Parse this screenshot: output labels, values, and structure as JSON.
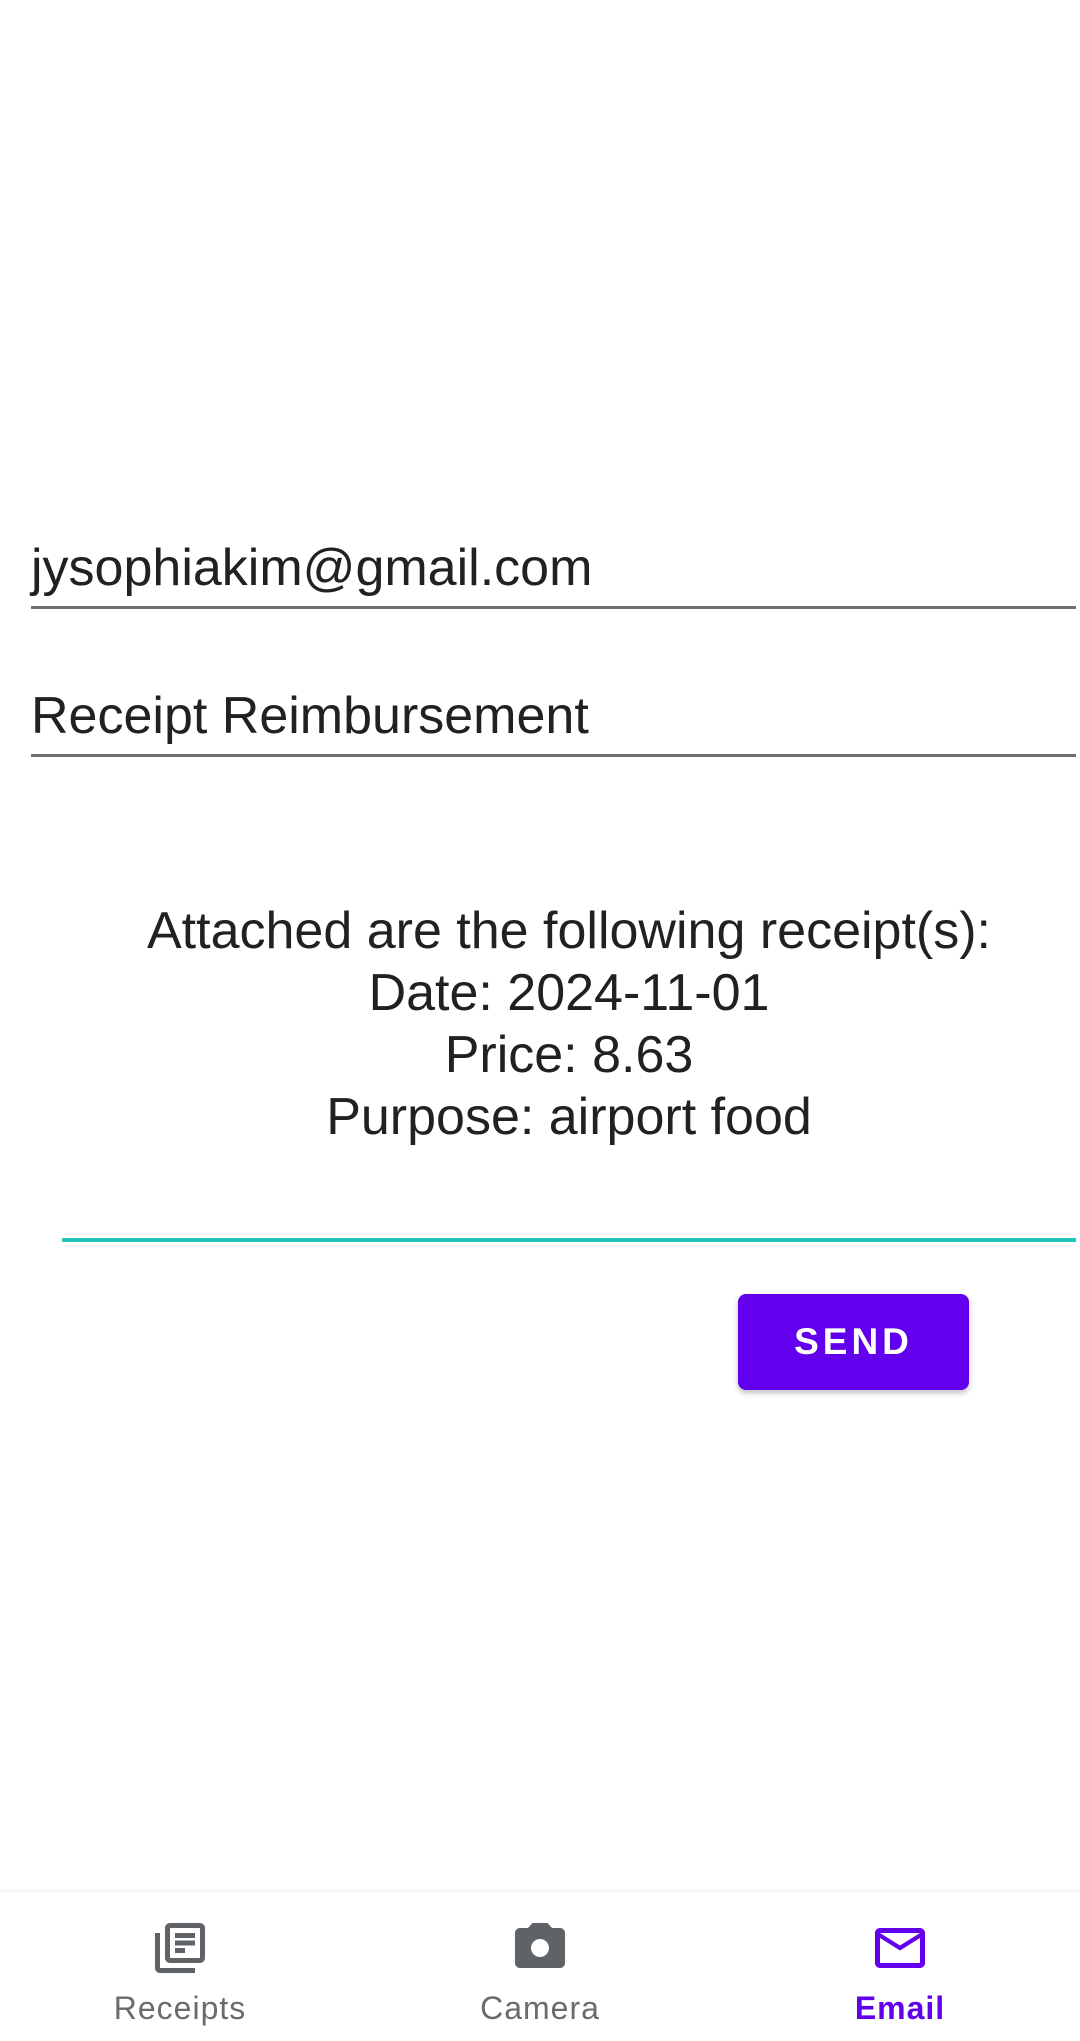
{
  "form": {
    "recipient": "jysophiakim@gmail.com",
    "subject": "Receipt Reimbursement",
    "body_lines": [
      "Attached are the following receipt(s):",
      "Date: 2024-11-01",
      "Price: 8.63",
      "Purpose: airport food"
    ],
    "send_label": "SEND"
  },
  "nav": {
    "items": [
      {
        "label": "Receipts",
        "icon": "receipts-icon",
        "active": false
      },
      {
        "label": "Camera",
        "icon": "camera-icon",
        "active": false
      },
      {
        "label": "Email",
        "icon": "email-icon",
        "active": true
      }
    ]
  },
  "colors": {
    "accent": "#6200ee",
    "focus_underline": "#21c7be",
    "inactive_icon": "#5f6368"
  }
}
